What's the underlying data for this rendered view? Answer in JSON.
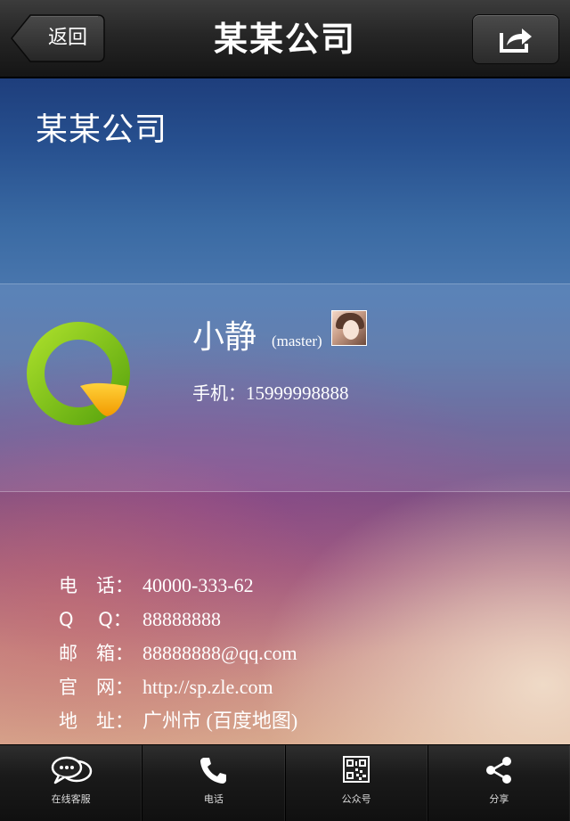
{
  "navbar": {
    "back_label": "返回",
    "title": "某某公司"
  },
  "company": {
    "name": "某某公司"
  },
  "card": {
    "person_name": "小静",
    "role": "(master)",
    "mobile_label": "手机：",
    "mobile_value": "15999998888"
  },
  "info": [
    {
      "label": "电　话：",
      "value": "40000-333-62"
    },
    {
      "label": "Q　  Q：",
      "value": "88888888"
    },
    {
      "label": "邮　箱：",
      "value": "88888888@qq.com"
    },
    {
      "label": "官　网：",
      "value": "http://sp.zle.com"
    },
    {
      "label": "地　址：",
      "value": "广州市 (百度地图)"
    }
  ],
  "tabs": [
    {
      "label": "在线客服",
      "icon": "chat-bubbles-icon"
    },
    {
      "label": "电话",
      "icon": "phone-icon"
    },
    {
      "label": "公众号",
      "icon": "qr-code-icon"
    },
    {
      "label": "分享",
      "icon": "share-nodes-icon"
    }
  ],
  "colors": {
    "logo_green": "#7cc51a",
    "logo_orange": "#f6a800"
  }
}
